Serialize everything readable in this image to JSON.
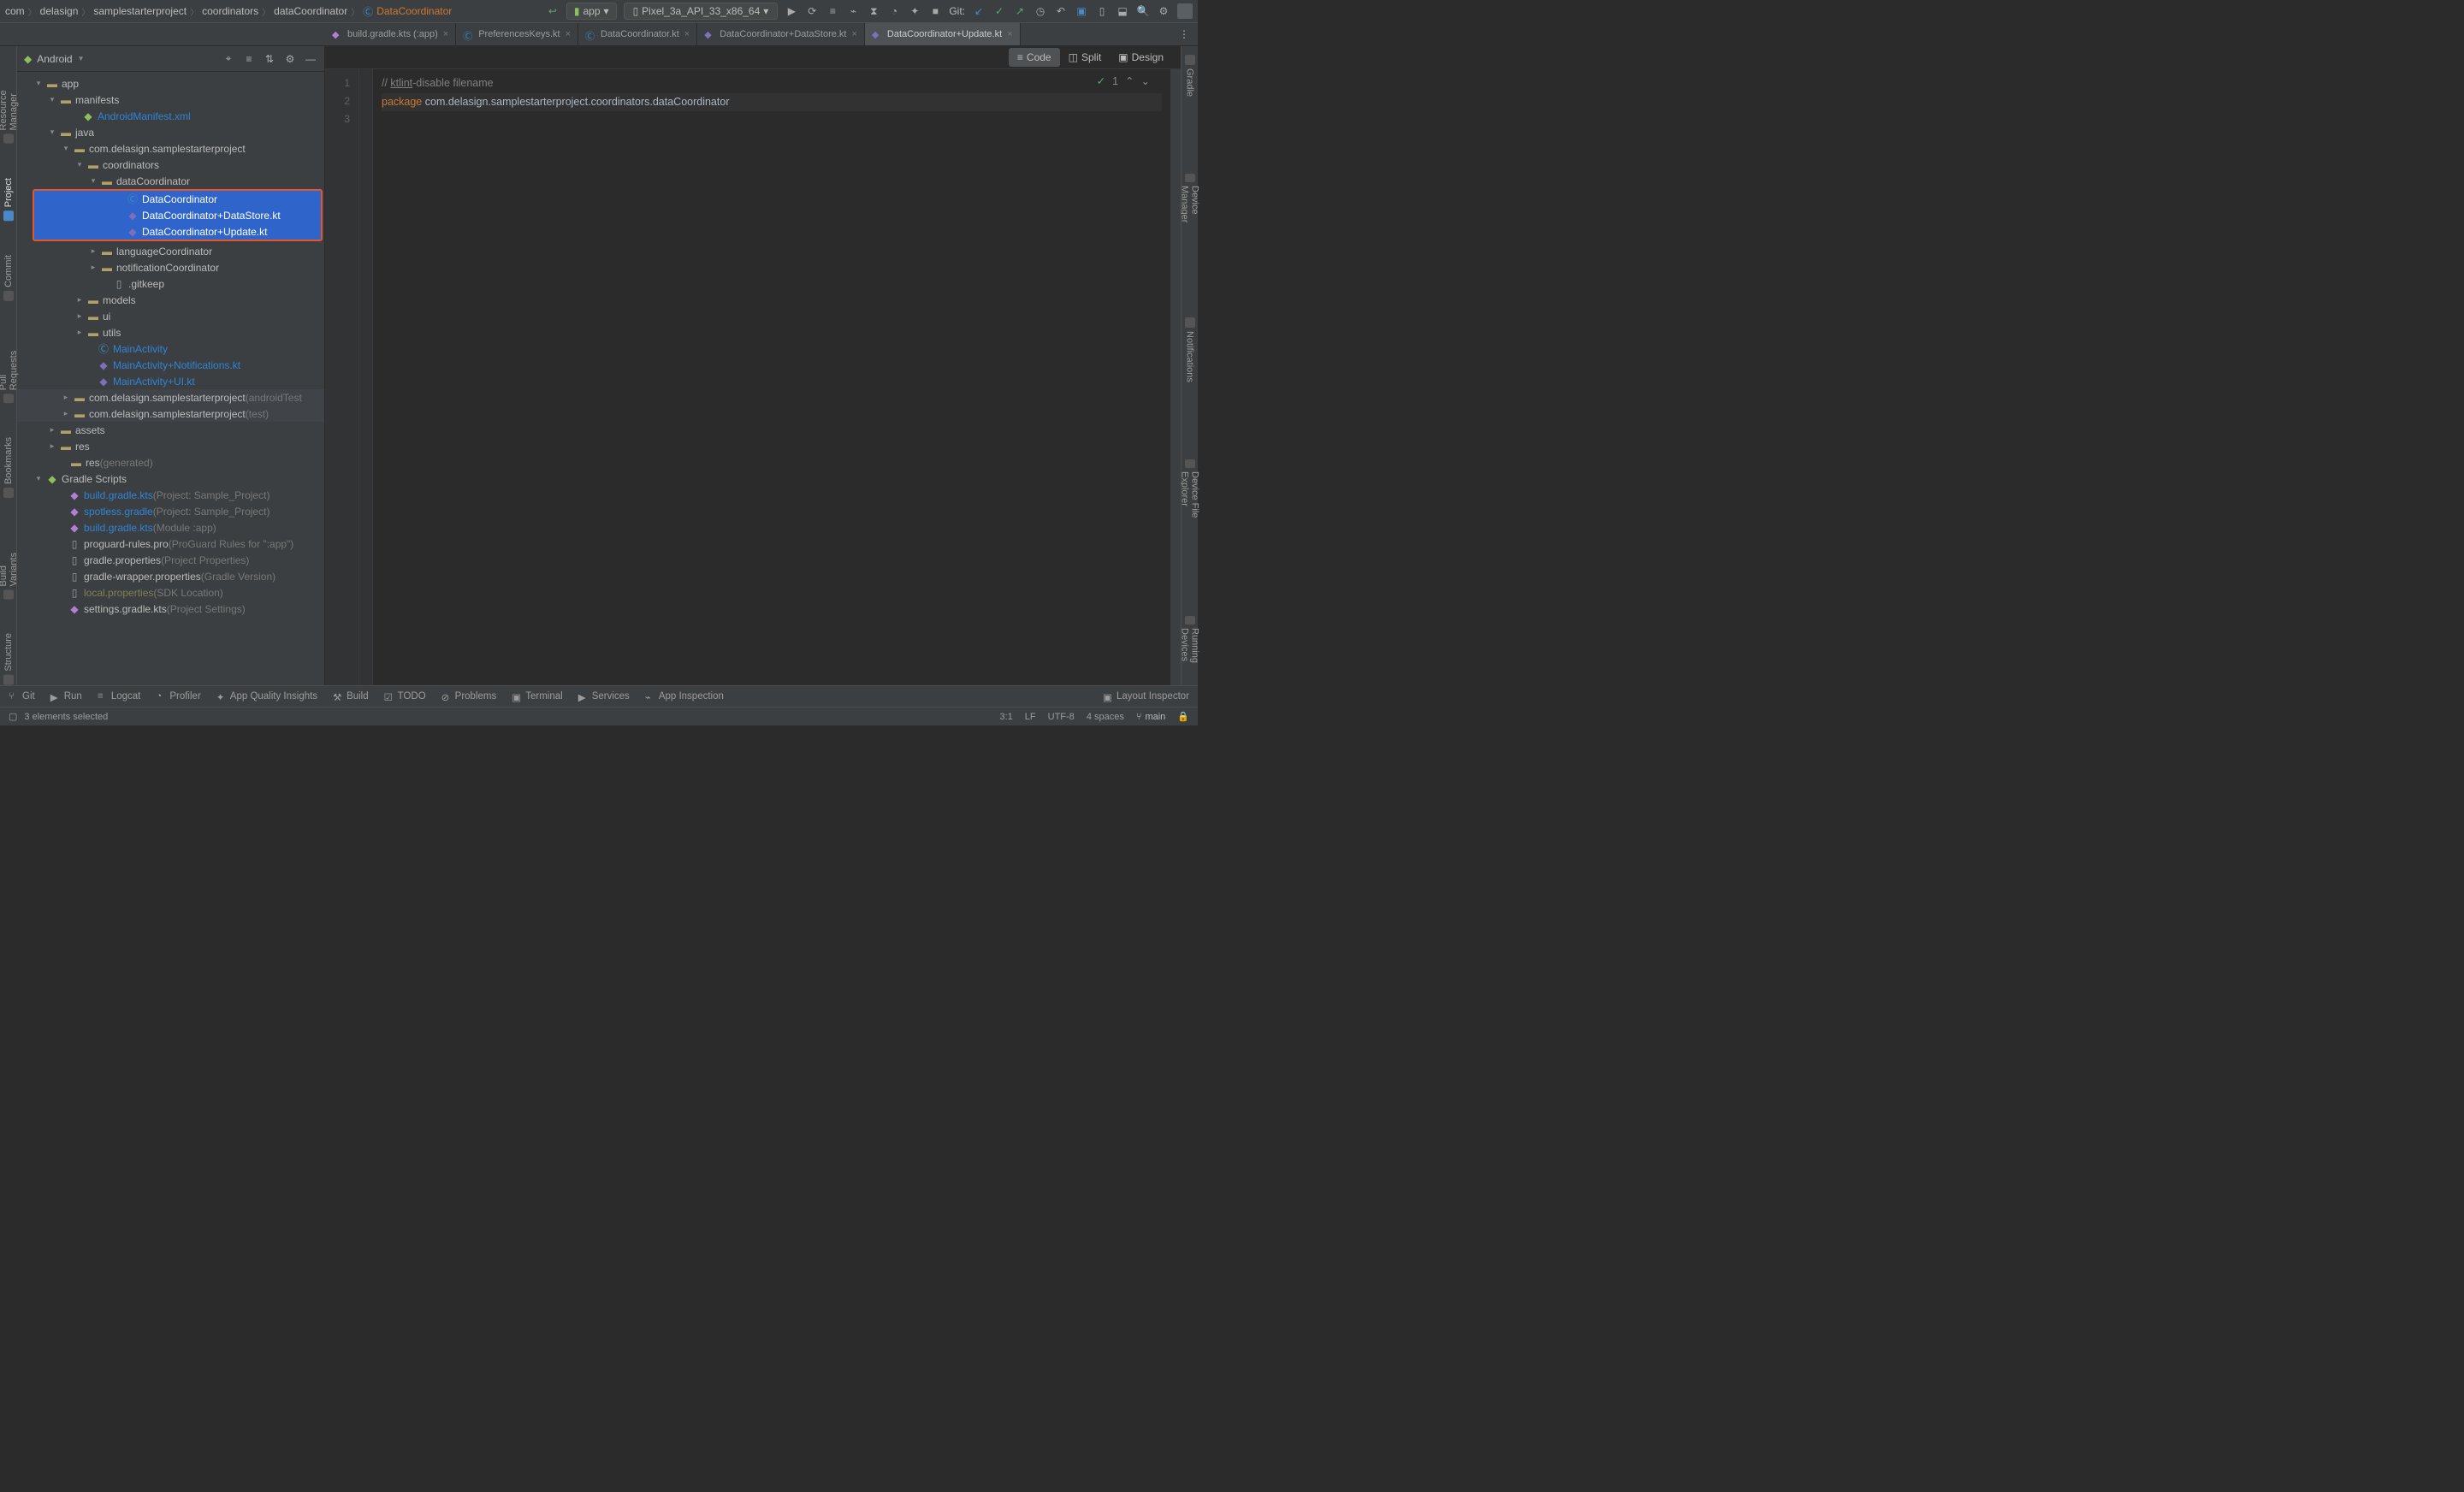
{
  "breadcrumbs": [
    "com",
    "delasign",
    "samplestarterproject",
    "coordinators",
    "dataCoordinator",
    "DataCoordinator"
  ],
  "nav": {
    "git_label": "Git:",
    "run_config_app": "app",
    "run_config_device": "Pixel_3a_API_33_x86_64",
    "dropdown_caret": "▾"
  },
  "tabs": [
    {
      "label": "build.gradle.kts (:app)",
      "active": false
    },
    {
      "label": "PreferencesKeys.kt",
      "active": false
    },
    {
      "label": "DataCoordinator.kt",
      "active": false
    },
    {
      "label": "DataCoordinator+DataStore.kt",
      "active": false
    },
    {
      "label": "DataCoordinator+Update.kt",
      "active": true
    }
  ],
  "panel": {
    "title": "Android",
    "icons": {
      "target": "⌖",
      "sort": "≡",
      "filter": "⇅",
      "gear": "⚙",
      "hide": "—"
    }
  },
  "tree": {
    "app": "app",
    "manifests": "manifests",
    "android_manifest": "AndroidManifest.xml",
    "java": "java",
    "pkg": "com.delasign.samplestarterproject",
    "coordinators": "coordinators",
    "dataCoordinator": "dataCoordinator",
    "DataCoordinator": "DataCoordinator",
    "DataCoordinatorDS": "DataCoordinator+DataStore.kt",
    "DataCoordinatorUp": "DataCoordinator+Update.kt",
    "languageCoordinator": "languageCoordinator",
    "notificationCoordinator": "notificationCoordinator",
    "gitkeep": ".gitkeep",
    "models": "models",
    "ui": "ui",
    "utils": "utils",
    "MainActivity": "MainActivity",
    "MainActivityNotif": "MainActivity+Notifications.kt",
    "MainActivityUI": "MainActivity+UI.kt",
    "pkg_test_a": "com.delasign.samplestarterproject",
    "pkg_test_a_suf": "(androidTest",
    "pkg_test_b": "com.delasign.samplestarterproject",
    "pkg_test_b_suf": "(test)",
    "assets": "assets",
    "res": "res",
    "res_gen": "res",
    "res_gen_suf": "(generated)",
    "gradle_scripts": "Gradle Scripts",
    "bgk_proj": "build.gradle.kts",
    "bgk_proj_suf": "(Project: Sample_Project)",
    "spotless": "spotless.gradle",
    "spotless_suf": "(Project: Sample_Project)",
    "bgk_mod": "build.gradle.kts",
    "bgk_mod_suf": "(Module :app)",
    "proguard": "proguard-rules.pro",
    "proguard_suf": "(ProGuard Rules for \":app\")",
    "gprops": "gradle.properties",
    "gprops_suf": "(Project Properties)",
    "gwprops": "gradle-wrapper.properties",
    "gwprops_suf": "(Gradle Version)",
    "localprops": "local.properties",
    "localprops_suf": "(SDK Location)",
    "settings": "settings.gradle.kts",
    "settings_suf": "(Project Settings)"
  },
  "left_gutter": [
    "Resource Manager",
    "Project",
    "Commit",
    "Pull Requests",
    "Bookmarks",
    "Build Variants",
    "Structure"
  ],
  "right_gutter": [
    "Gradle",
    "Device Manager",
    "Notifications",
    "Device File Explorer",
    "Running Devices"
  ],
  "design": {
    "code": "Code",
    "split": "Split",
    "design": "Design"
  },
  "code": {
    "l1_a": "// ",
    "l1_b": "ktlint",
    "l1_c": "-disable filename",
    "l2_a": "package",
    "l2_b": " com.delasign.samplestarterproject.coordinators.dataCoordinator",
    "lines": [
      "1",
      "2",
      "3"
    ],
    "overlay_count": "1",
    "overlay_check": "✓",
    "overlay_up": "⌃",
    "overlay_down": "⌄"
  },
  "bottom_tools": {
    "git": "Git",
    "run": "Run",
    "logcat": "Logcat",
    "profiler": "Profiler",
    "aqi": "App Quality Insights",
    "build": "Build",
    "todo": "TODO",
    "problems": "Problems",
    "terminal": "Terminal",
    "services": "Services",
    "inspect": "App Inspection",
    "layout": "Layout Inspector"
  },
  "status": {
    "selected": "3 elements selected",
    "pos": "3:1",
    "enc": "LF",
    "charset": "UTF-8",
    "indent": "4 spaces",
    "branch": "main",
    "lock": "🔒"
  }
}
